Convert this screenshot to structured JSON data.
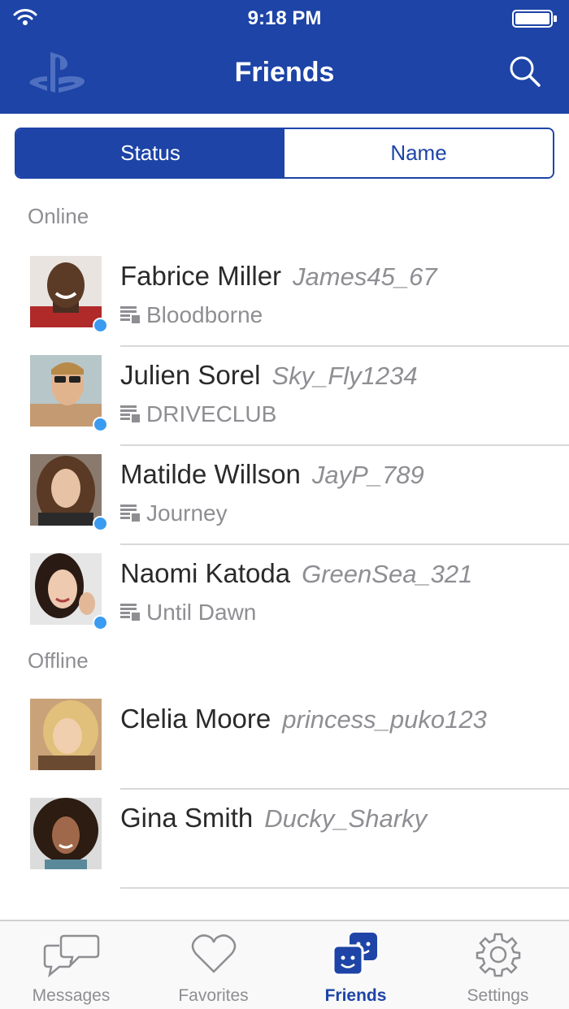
{
  "status_bar": {
    "time": "9:18 PM"
  },
  "header": {
    "title": "Friends",
    "logo_icon": "playstation-logo-icon",
    "search_icon": "search-icon"
  },
  "segmented": {
    "status_label": "Status",
    "name_label": "Name",
    "selected": "Status"
  },
  "sections": {
    "online_label": "Online",
    "offline_label": "Offline"
  },
  "friends": [
    {
      "name": "Fabrice Miller",
      "psn": "James45_67",
      "game": "Bloodborne",
      "online": true
    },
    {
      "name": "Julien Sorel",
      "psn": "Sky_Fly1234",
      "game": "DRIVECLUB",
      "online": true
    },
    {
      "name": "Matilde Willson",
      "psn": "JayP_789",
      "game": "Journey",
      "online": true
    },
    {
      "name": "Naomi Katoda",
      "psn": "GreenSea_321",
      "game": "Until Dawn",
      "online": true
    },
    {
      "name": "Clelia Moore",
      "psn": "princess_puko123",
      "game": "",
      "online": false
    },
    {
      "name": "Gina Smith",
      "psn": "Ducky_Sharky",
      "game": "",
      "online": false
    }
  ],
  "tabbar": {
    "tabs": [
      {
        "label": "Messages",
        "icon": "messages-icon"
      },
      {
        "label": "Favorites",
        "icon": "heart-icon"
      },
      {
        "label": "Friends",
        "icon": "friends-icon"
      },
      {
        "label": "Settings",
        "icon": "gear-icon"
      }
    ],
    "active": "Friends"
  },
  "colors": {
    "brand": "#1d44a6",
    "online_dot": "#3a9bf0",
    "secondary_text": "#8e8e93"
  }
}
